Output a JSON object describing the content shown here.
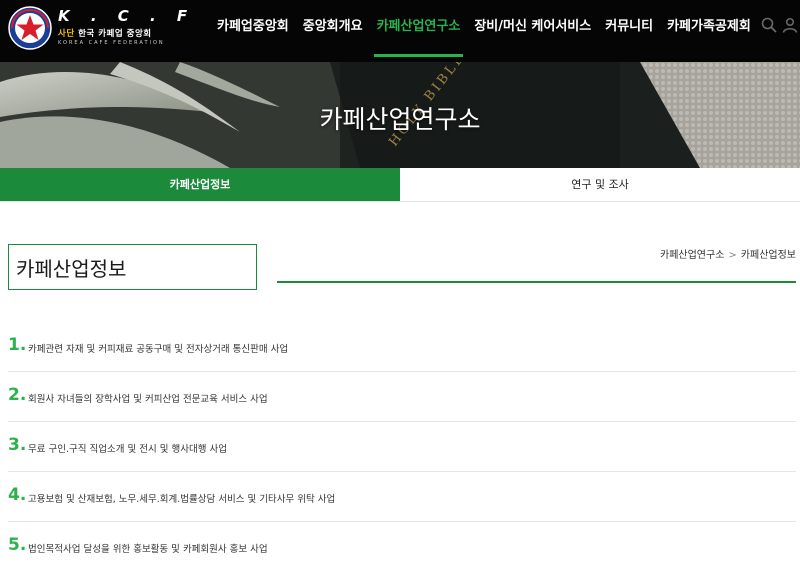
{
  "brand": {
    "logo_text": "K . C . F",
    "korean_prefix": "사단",
    "korean_name": "한국 카페업 중앙회",
    "english_name": "KOREA CAFE FEDERATION",
    "emblem_text": "KOREA CAFE FEDERATION"
  },
  "nav": {
    "items": [
      {
        "label": "카페업중앙회",
        "active": false
      },
      {
        "label": "중앙회개요",
        "active": false
      },
      {
        "label": "카페산업연구소",
        "active": true
      },
      {
        "label": "장비/머신 케어서비스",
        "active": false
      },
      {
        "label": "커뮤니티",
        "active": false
      },
      {
        "label": "카페가족공제회",
        "active": false
      }
    ],
    "icons": [
      "search-icon",
      "user-icon"
    ]
  },
  "banner": {
    "title": "카페산업연구소",
    "background_text": "HOLY BIBLE"
  },
  "subtabs": [
    {
      "label": "카페산업정보",
      "active": true
    },
    {
      "label": "연구 및 조사",
      "active": false
    }
  ],
  "section": {
    "title": "카페산업정보",
    "breadcrumb": [
      "카페산업연구소",
      "카페산업정보"
    ],
    "breadcrumb_separator": ">"
  },
  "items": [
    {
      "num": "1.",
      "text": "카페관련 자재 및 커피재료 공동구매 및 전자상거래 통신판매 사업"
    },
    {
      "num": "2.",
      "text": "회원사 자녀들의 장학사업 및 커피산업 전문교육 서비스 사업"
    },
    {
      "num": "3.",
      "text": "무료 구인.구직 직업소개 및 전시 및 행사대행 사업"
    },
    {
      "num": "4.",
      "text": "고용보험 및 산재보험, 노무.세무.회계.법률상담 서비스 및 기타사무 위탁 사업"
    },
    {
      "num": "5.",
      "text": "법인목적사업 달성을 위한 홍보활동 및 카페회원사 홍보 사업"
    }
  ],
  "colors": {
    "accent_green": "#2bb24c",
    "tab_green": "#1c8a3b",
    "header_bg": "#050505"
  }
}
